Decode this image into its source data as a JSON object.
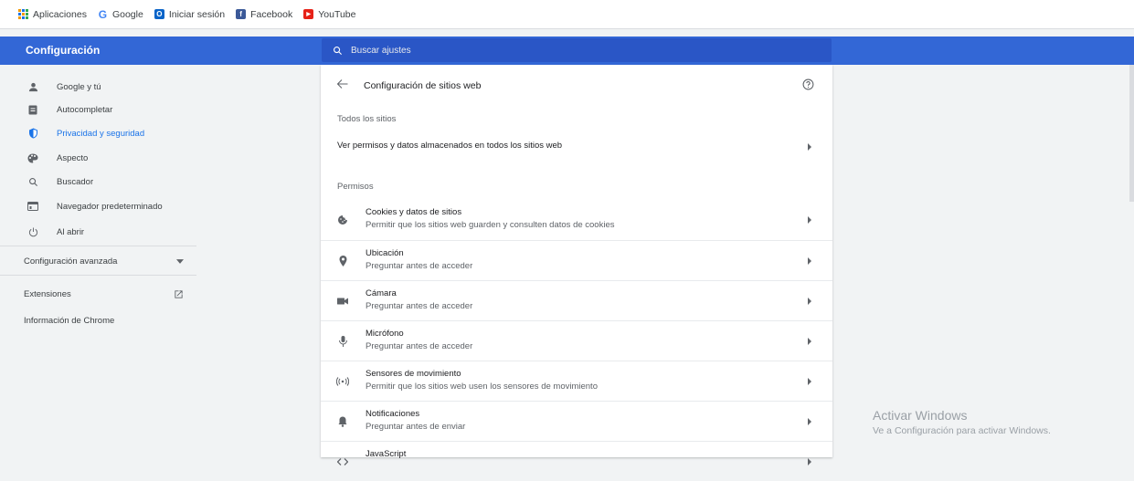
{
  "bookmarks": [
    {
      "label": "Aplicaciones",
      "icon": "apps-grid-icon"
    },
    {
      "label": "Google",
      "icon": "google-icon"
    },
    {
      "label": "Iniciar sesión",
      "icon": "outlook-icon"
    },
    {
      "label": "Facebook",
      "icon": "facebook-icon"
    },
    {
      "label": "YouTube",
      "icon": "youtube-icon"
    }
  ],
  "header": {
    "title": "Configuración",
    "search_placeholder": "Buscar ajustes",
    "color": "#3367d6"
  },
  "sidebar": {
    "items": [
      {
        "label": "Google y tú",
        "icon": "person-icon"
      },
      {
        "label": "Autocompletar",
        "icon": "clipboard-icon"
      },
      {
        "label": "Privacidad y seguridad",
        "icon": "shield-icon",
        "active": true
      },
      {
        "label": "Aspecto",
        "icon": "palette-icon"
      },
      {
        "label": "Buscador",
        "icon": "search-icon"
      },
      {
        "label": "Navegador predeterminado",
        "icon": "browser-icon"
      },
      {
        "label": "Al abrir",
        "icon": "power-icon"
      }
    ],
    "advanced": "Configuración avanzada",
    "extensions": "Extensiones",
    "about": "Información de Chrome"
  },
  "page": {
    "title": "Configuración de sitios web",
    "all_sites_header": "Todos los sitios",
    "all_sites_link": "Ver permisos y datos almacenados en todos los sitios web",
    "permissions_header": "Permisos",
    "permissions": [
      {
        "title": "Cookies y datos de sitios",
        "subtitle": "Permitir que los sitios web guarden y consulten datos de cookies",
        "icon": "cookie-icon"
      },
      {
        "title": "Ubicación",
        "subtitle": "Preguntar antes de acceder",
        "icon": "location-pin-icon"
      },
      {
        "title": "Cámara",
        "subtitle": "Preguntar antes de acceder",
        "icon": "camera-icon"
      },
      {
        "title": "Micrófono",
        "subtitle": "Preguntar antes de acceder",
        "icon": "microphone-icon"
      },
      {
        "title": "Sensores de movimiento",
        "subtitle": "Permitir que los sitios web usen los sensores de movimiento",
        "icon": "motion-sensor-icon"
      },
      {
        "title": "Notificaciones",
        "subtitle": "Preguntar antes de enviar",
        "icon": "bell-icon"
      },
      {
        "title": "JavaScript",
        "subtitle": "",
        "icon": "code-icon"
      }
    ]
  },
  "watermark": {
    "line1": "Activar Windows",
    "line2": "Ve a Configuración para activar Windows."
  }
}
